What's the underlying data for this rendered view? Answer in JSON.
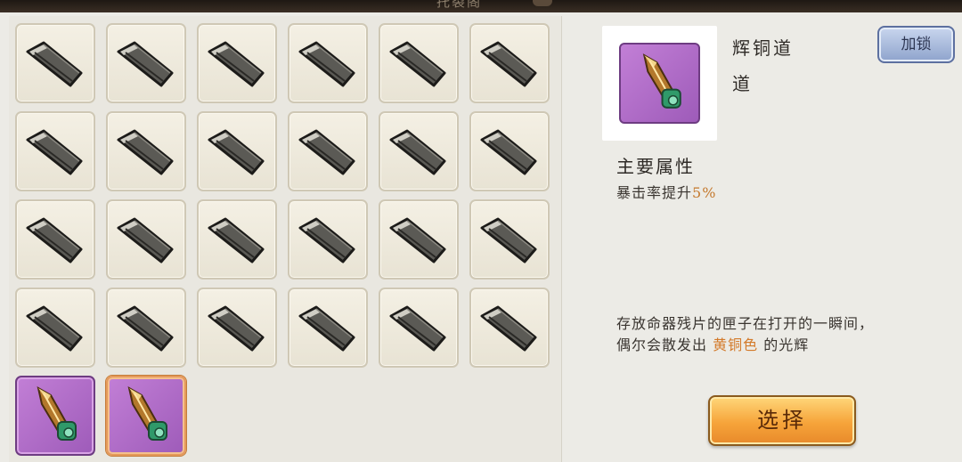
{
  "header": {
    "title": "托裂阁",
    "ornament_icon": "scroll-ornament-icon"
  },
  "inventory": {
    "fragment_icon": "dark-blade-fragment-icon",
    "fragment_slot_count": 24,
    "gem_slot_count": 2,
    "selected_gem_index": 1
  },
  "detail": {
    "item_name": "辉铜道",
    "item_type": "道",
    "item_icon": "bronze-dagger-gem-icon",
    "lock_label": "加锁",
    "section_title": "主要属性",
    "attr_text": "暴击率提升",
    "attr_value": "5%",
    "desc_line1": "存放命器残片的匣子在打开的一瞬间，",
    "desc_line2_before": "偶尔会散发出 ",
    "desc_highlight": "黄铜色",
    "desc_line2_after": " 的光辉",
    "select_label": "选择"
  },
  "colors": {
    "highlight": "#d37a2a",
    "gem_bg": "#b06cc8",
    "lock_btn": "#aabbdd",
    "select_btn": "#f6a43a"
  }
}
